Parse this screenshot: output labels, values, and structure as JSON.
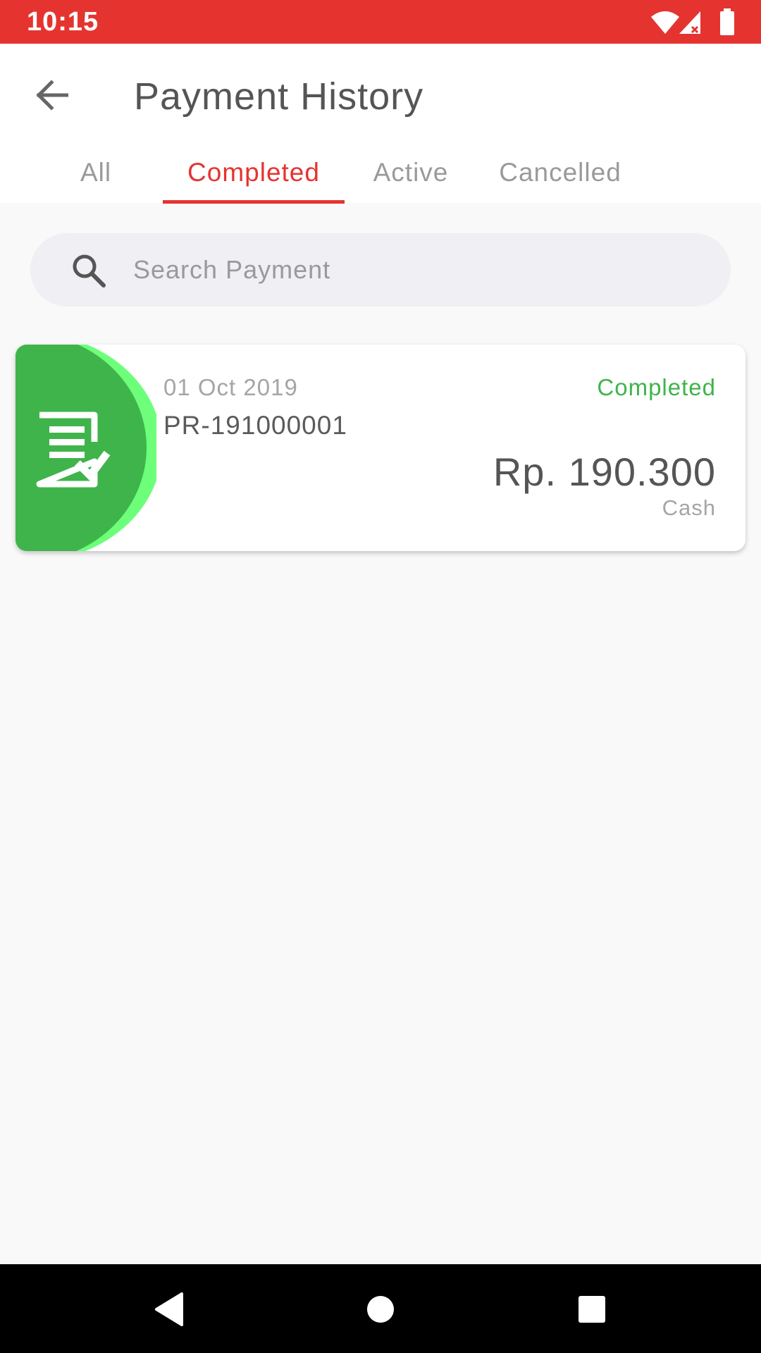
{
  "status_bar": {
    "time": "10:15",
    "icons": [
      "wifi-icon",
      "cell-signal-icon",
      "battery-icon"
    ],
    "color": "#e53430"
  },
  "header": {
    "title": "Payment History",
    "back_icon": "arrow-left-icon"
  },
  "tabs": [
    {
      "label": "All",
      "active": false
    },
    {
      "label": "Completed",
      "active": true
    },
    {
      "label": "Active",
      "active": false
    },
    {
      "label": "Cancelled",
      "active": false
    }
  ],
  "search": {
    "placeholder": "Search Payment",
    "value": "",
    "icon": "search-icon"
  },
  "payments": [
    {
      "date": "01 Oct 2019",
      "id": "PR-191000001",
      "status": "Completed",
      "amount": "Rp. 190.300",
      "method": "Cash",
      "icon": "receipt-check-icon",
      "status_color": "#3fb44a"
    }
  ],
  "nav": {
    "icons": [
      "back-triangle-icon",
      "home-circle-icon",
      "recents-square-icon"
    ]
  },
  "colors": {
    "accent": "#e53430",
    "success": "#3fb44a",
    "success_light": "#6dff7a"
  }
}
